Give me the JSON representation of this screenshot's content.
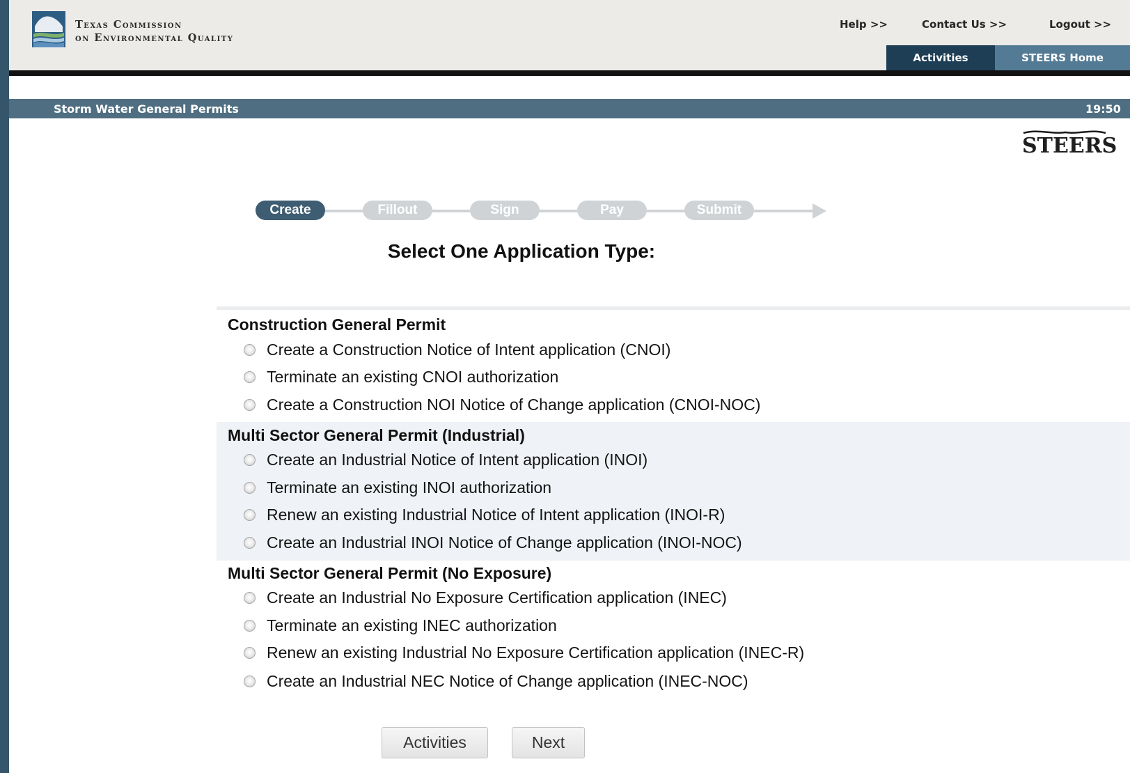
{
  "header": {
    "org_line1": "Texas Commission",
    "org_line2": "on Environmental Quality",
    "links": {
      "help": "Help >>",
      "contact": "Contact Us >>",
      "logout": "Logout >>"
    },
    "tabs": {
      "activities": "Activities",
      "home": "STEERS Home"
    }
  },
  "titlebar": {
    "title": "Storm Water General Permits",
    "time": "19:50"
  },
  "steers_logo_text": "STEERS",
  "steps": [
    "Create",
    "Fillout",
    "Sign",
    "Pay",
    "Submit"
  ],
  "active_step": "Create",
  "heading": "Select One Application Type:",
  "groups": [
    {
      "title": "Construction General Permit",
      "options": [
        "Create a Construction Notice of Intent application (CNOI)",
        "Terminate an existing CNOI authorization",
        "Create a Construction NOI Notice of Change application (CNOI-NOC)"
      ]
    },
    {
      "title": "Multi Sector General Permit (Industrial)",
      "options": [
        "Create an Industrial Notice of Intent application (INOI)",
        "Terminate an existing INOI authorization",
        "Renew an existing Industrial Notice of Intent application (INOI-R)",
        "Create an Industrial INOI Notice of Change application (INOI-NOC)"
      ]
    },
    {
      "title": "Multi Sector General Permit (No Exposure)",
      "options": [
        "Create an Industrial No Exposure Certification application (INEC)",
        "Terminate an existing INEC authorization",
        "Renew an existing Industrial No Exposure Certification application (INEC-R)",
        "Create an Industrial NEC Notice of Change application (INEC-NOC)"
      ]
    }
  ],
  "buttons": {
    "activities": "Activities",
    "next": "Next"
  },
  "colors": {
    "page_border": "#35556a",
    "title_bar": "#4f6e81",
    "tab_active": "#1d3e55",
    "tab_home": "#547b95",
    "step_active": "#3e5d72",
    "step_inactive": "#cfd3d6",
    "band": "#eff2f6"
  },
  "icons": {
    "logo": "tceq-texas-logo",
    "brand": "steers-longhorn-logo",
    "radio": "radio-unchecked-icon",
    "arrow": "step-arrow-icon"
  }
}
